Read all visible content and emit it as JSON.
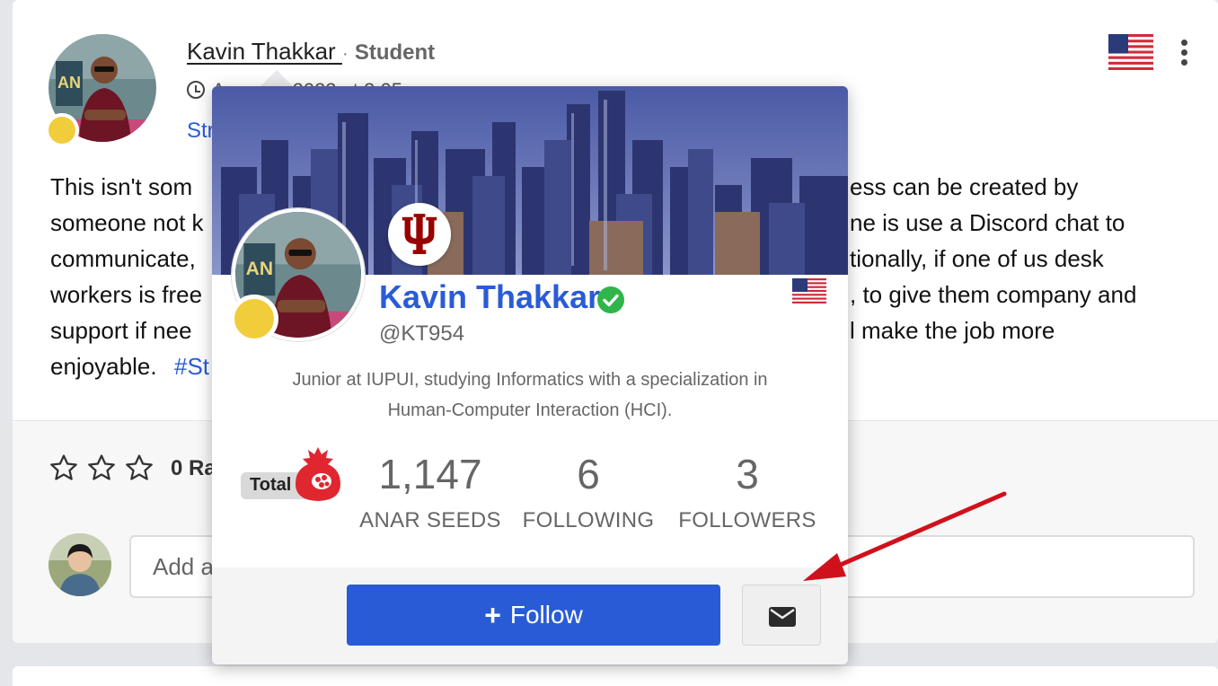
{
  "post": {
    "author_name": "Kavin Thakkar ",
    "separator": "·",
    "author_role": "Student",
    "time_visible": "A",
    "time_visible_right": "2022 at 3:05",
    "category_link": "Str",
    "body_lines": [
      {
        "left": "This isn't som",
        "right": "ess can be created by"
      },
      {
        "left": "someone not k",
        "right": "ne is use a Discord chat to"
      },
      {
        "left": "communicate,",
        "right": "tionally, if one of us desk"
      },
      {
        "left": "workers is free",
        "right": ", to give them company and"
      },
      {
        "left": "support if nee",
        "right": "l make the job more"
      },
      {
        "left": "enjoyable.",
        "hashtag": "#St"
      }
    ],
    "rating_label": "0 Ra",
    "comment_placeholder": "Add a"
  },
  "popover": {
    "name": "Kavin Thakkar",
    "handle": "@KT954",
    "bio_line1": "Junior at IUPUI, studying Informatics with a specialization in",
    "bio_line2": "Human-Computer Interaction (HCI).",
    "total_label": "Total",
    "stats": [
      {
        "value": "1,147",
        "label": "ANAR SEEDS"
      },
      {
        "value": "6",
        "label": "FOLLOWING"
      },
      {
        "value": "3",
        "label": "FOLLOWERS"
      }
    ],
    "follow_label": "Follow",
    "follow_icon": "+"
  },
  "colors": {
    "accent": "#2a5bd7",
    "status_dot": "#f1cd3c",
    "verified": "#2fb54a",
    "arrow": "#d0111b",
    "school": "#990000"
  },
  "icons": [
    "clock-icon",
    "us-flag-icon",
    "more-vertical-icon",
    "star-outline-icon",
    "verified-check-icon",
    "anar-seed-icon",
    "plus-icon",
    "envelope-icon",
    "iu-trident-logo"
  ]
}
